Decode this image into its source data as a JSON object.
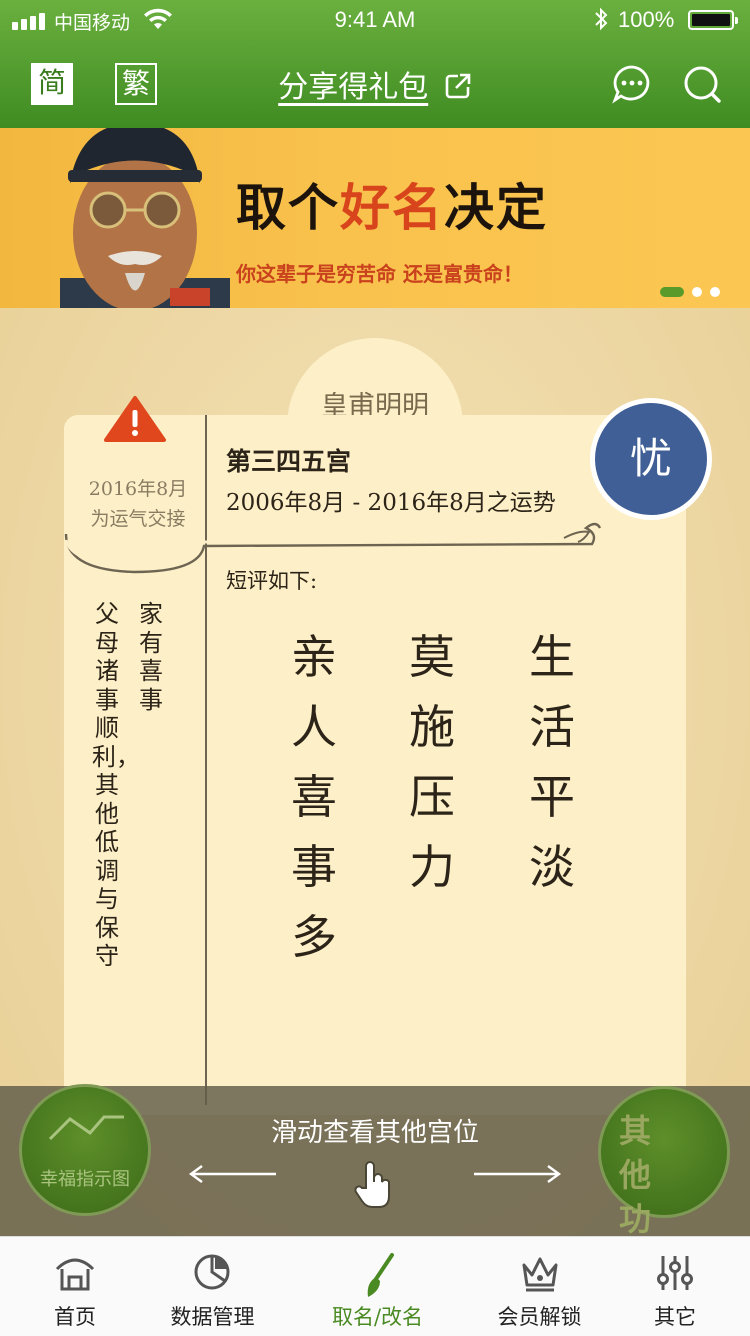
{
  "status_bar": {
    "carrier": "中国移动",
    "time": "9:41 AM",
    "battery": "100%"
  },
  "header": {
    "simplified_label": "简",
    "traditional_label": "繁",
    "share_label": "分享得礼包",
    "icons": [
      "share-out-icon",
      "chat-bubble-icon",
      "search-icon"
    ]
  },
  "banner": {
    "title_pre": "取个",
    "title_highlight": "好名",
    "title_post": "决定",
    "subtitle": "你这辈子是穷苦命 还是富贵命！",
    "slide_index": 1,
    "slide_count": 3
  },
  "card": {
    "person_name": "皇甫明明",
    "transition_date": "2016年8月",
    "transition_label": "为运气交接",
    "palace_name": "第三四五宫",
    "period": "2006年8月 - 2016年8月之运势",
    "mood": "忧",
    "review_label": "短评如下:",
    "verses": [
      "亲人喜事多",
      "莫施压力",
      "生活平淡"
    ],
    "left_notes": [
      "家有喜事",
      "父母诸事顺利，其他低调与保守"
    ]
  },
  "overlay": {
    "chart_button_label": "幸福指示图",
    "swipe_hint": "滑动查看其他宫位",
    "other_functions_label": "其他功能"
  },
  "tabbar": {
    "items": [
      {
        "label": "首页",
        "icon": "home-icon",
        "active": false
      },
      {
        "label": "数据管理",
        "icon": "pie-chart-icon",
        "active": false
      },
      {
        "label": "取名/改名",
        "icon": "brush-icon",
        "active": true
      },
      {
        "label": "会员解锁",
        "icon": "crown-icon",
        "active": false
      },
      {
        "label": "其它",
        "icon": "sliders-icon",
        "active": false
      }
    ]
  },
  "colors": {
    "header_green": "#4a9a2a",
    "banner_accent": "#d8451d",
    "mood_blue": "#3f5f96",
    "active_tab": "#4a8a22"
  }
}
